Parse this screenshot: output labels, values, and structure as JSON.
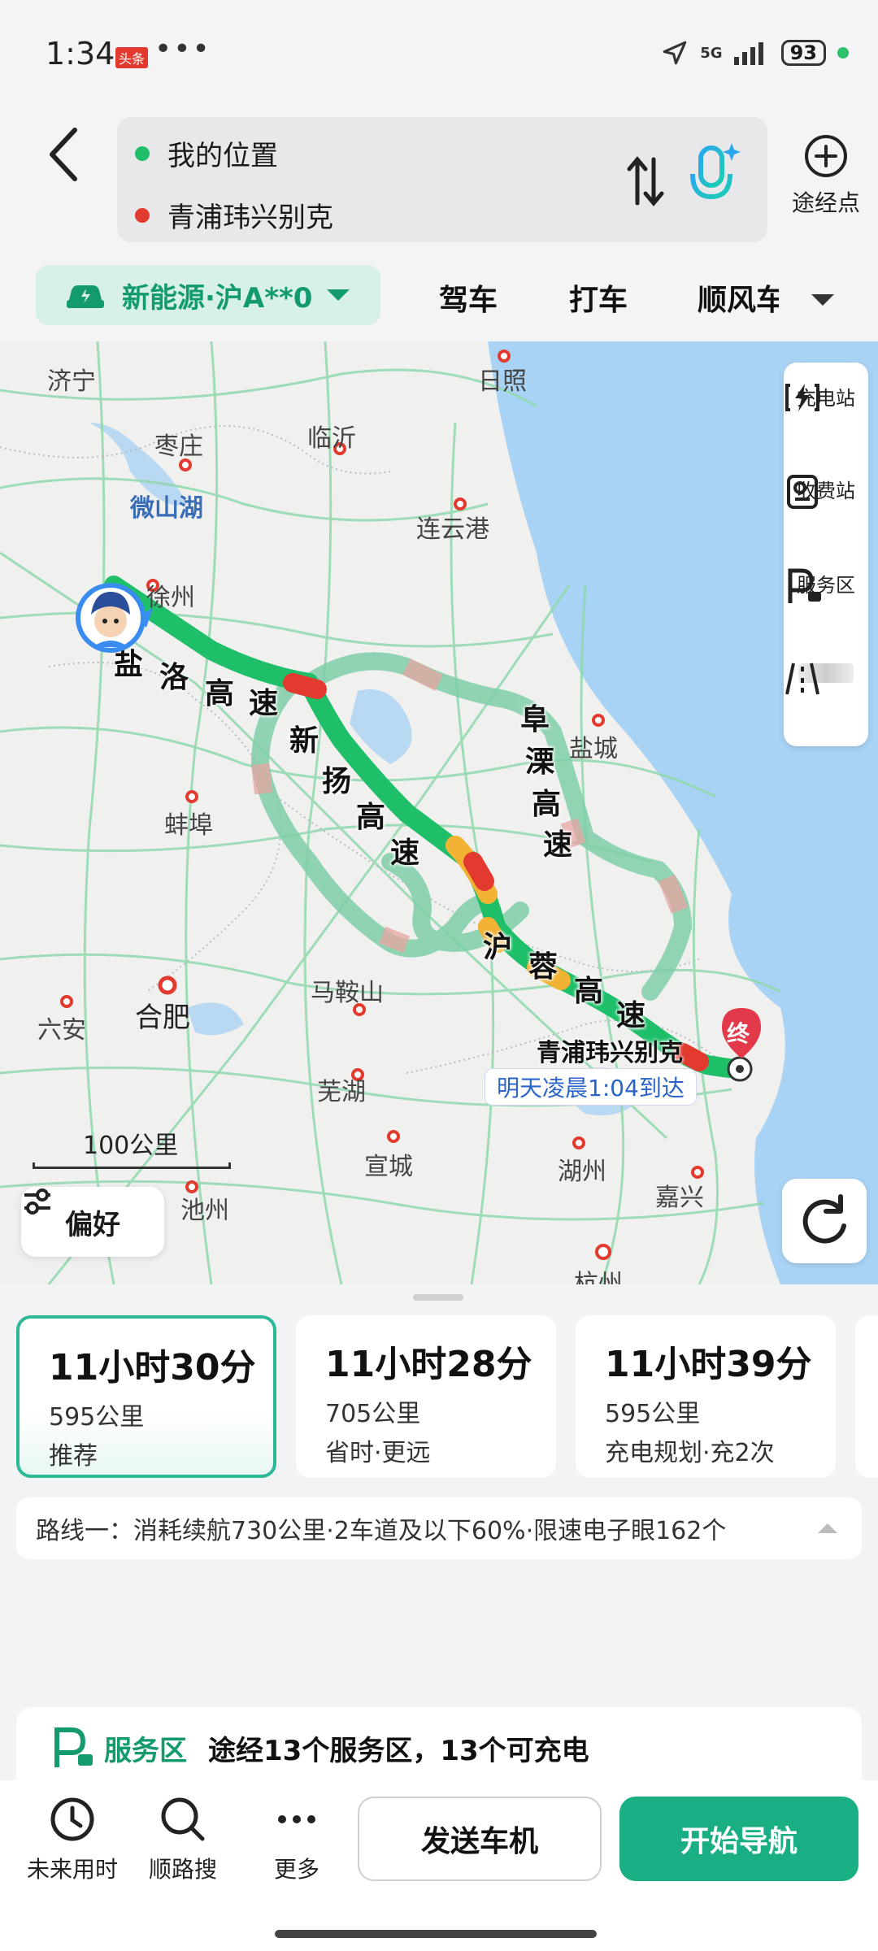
{
  "status_bar": {
    "time": "1:34",
    "badge": "头条",
    "more": "•••",
    "signal": "5G",
    "battery": "93"
  },
  "header": {
    "origin": "我的位置",
    "destination": "青浦玮兴别克",
    "waypoint_label": "途经点"
  },
  "modes": {
    "ev_chip": "新能源·沪A**0",
    "tabs": [
      "驾车",
      "打车",
      "顺风车"
    ]
  },
  "map": {
    "cities": [
      "济宁",
      "日照",
      "枣庄",
      "临沂",
      "微山湖",
      "连云港",
      "徐州",
      "盐城",
      "蚌埠",
      "马鞍山",
      "合肥",
      "六安",
      "芜湖",
      "宣城",
      "湖州",
      "嘉兴",
      "池州",
      "杭州"
    ],
    "highways": {
      "yanluo": [
        "盐",
        "洛",
        "高",
        "速"
      ],
      "xinyang": [
        "新",
        "扬",
        "高",
        "速"
      ],
      "fuli": [
        "阜",
        "溧",
        "高",
        "速"
      ],
      "hurong": [
        "沪",
        "蓉",
        "高",
        "速"
      ]
    },
    "side_tools": [
      "充电站",
      "收费站",
      "服务区",
      ""
    ],
    "scale": "100公里",
    "preference": "偏好",
    "dest_label": "青浦玮兴别克",
    "dest_pin": "终",
    "eta": "明天凌晨1:04到达",
    "colors": {
      "route_green": "#1fbf6a",
      "route_alt": "#7fcfa8",
      "jam_red": "#e23a2e",
      "slow_yellow": "#f2b233",
      "water": "#a9d3f5"
    }
  },
  "routes": [
    {
      "time": "11小时30分",
      "distance": "595公里",
      "tag": "推荐"
    },
    {
      "time": "11小时28分",
      "distance": "705公里",
      "tag": "省时·更远"
    },
    {
      "time": "11小时39分",
      "distance": "595公里",
      "tag": "充电规划·充2次"
    }
  ],
  "route_info": "路线一：消耗续航730公里·2车道及以下60%·限速电子眼162个",
  "service": {
    "title": "服务区",
    "desc": "途经13个服务区，13个可充电"
  },
  "bottom": {
    "buttons": [
      "未来用时",
      "顺路搜",
      "更多"
    ],
    "send": "发送车机",
    "start": "开始导航"
  }
}
